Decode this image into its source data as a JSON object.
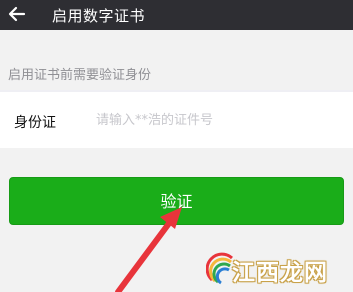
{
  "header": {
    "back_icon": "arrow-left-icon",
    "title": "启用数字证书"
  },
  "hint": "启用证书前需要验证身份",
  "form": {
    "id_label": "身份证",
    "id_placeholder": "请输入**浩的证件号",
    "id_value": ""
  },
  "verify_button": "验证",
  "watermark": {
    "text": "江西龙网",
    "icon": "rainbow-logo-icon"
  },
  "colors": {
    "header_bg": "#2e2e33",
    "button_bg": "#1aad19",
    "arrow": "#e8343b"
  }
}
